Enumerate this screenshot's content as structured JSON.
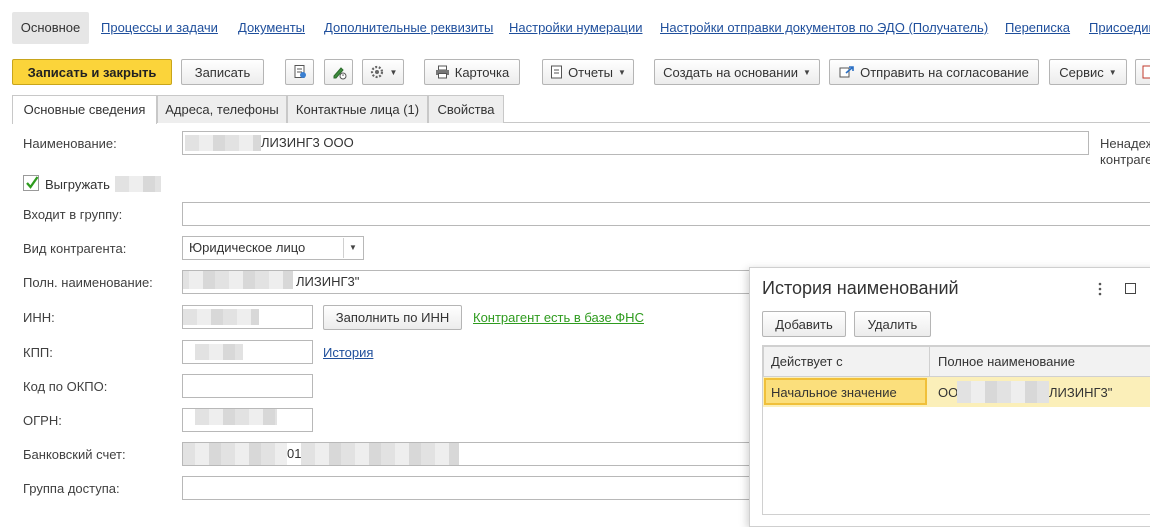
{
  "nav": {
    "active": "Основное",
    "links": [
      "Процессы и задачи",
      "Документы",
      "Дополнительные реквизиты",
      "Настройки нумерации",
      "Настройки отправки документов по ЭДО (Получатель)",
      "Переписка",
      "Присоедин"
    ]
  },
  "toolbar": {
    "save_close": "Записать и закрыть",
    "save": "Записать",
    "card": "Карточка",
    "reports": "Отчеты",
    "create_based": "Создать на основании",
    "send_approval": "Отправить на согласование",
    "service": "Сервис"
  },
  "tabs": [
    "Основные сведения",
    "Адреса, телефоны",
    "Контактные лица (1)",
    "Свойства"
  ],
  "form": {
    "name_label": "Наименование:",
    "name_value": "ЛИЗИНГ3  ООО",
    "side_note_line1": "Ненадеж",
    "side_note_line2": "контраге",
    "export_label": "Выгружать",
    "group_label": "Входит в группу:",
    "type_label": "Вид контрагента:",
    "type_value": "Юридическое лицо",
    "full_name_label": "Полн. наименование:",
    "full_name_value": "ЛИЗИНГ3\"",
    "inn_label": "ИНН:",
    "fill_inn_button": "Заполнить по ИНН",
    "fns_link": "Контрагент есть в базе ФНС",
    "kpp_label": "КПП:",
    "history_link": "История",
    "okpo_label": "Код по ОКПО:",
    "ogrn_label": "ОГРН:",
    "bank_label": "Банковский счет:",
    "bank_fragment": "01",
    "access_label": "Группа доступа:"
  },
  "popup": {
    "title": "История наименований",
    "add_button": "Добавить",
    "delete_button": "Удалить",
    "columns": [
      "Действует с",
      "Полное наименование"
    ],
    "rows": [
      {
        "from": "Начальное значение",
        "prefix": "ОО",
        "suffix": "ЛИЗИНГ3\""
      }
    ]
  },
  "colors": {
    "primary_button": "#fbd43a",
    "link": "#1f4f9c",
    "fns_link": "#2e9b1e",
    "selected_row": "#fbe9a8"
  }
}
